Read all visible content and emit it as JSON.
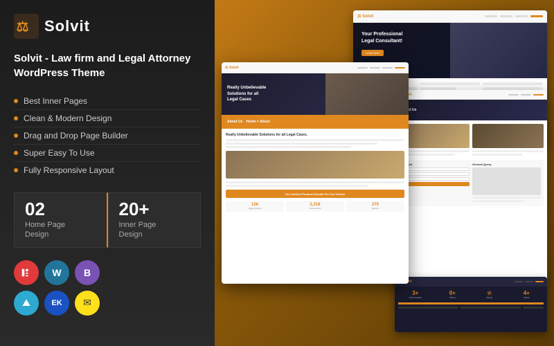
{
  "brand": {
    "name": "Solvit",
    "logo_symbol": "⚖"
  },
  "product": {
    "title": "Solvit - Law firm and Legal Attorney WordPress Theme",
    "features": [
      "Best Inner Pages",
      "Clean & Modern Design",
      "Drag and Drop Page Builder",
      "Super Easy To Use",
      "Fully Responsive Layout"
    ],
    "stats": [
      {
        "number": "02",
        "label": "Home Page\nDesign"
      },
      {
        "number": "20+",
        "label": "Inner Page\nDesign"
      }
    ]
  },
  "icons": [
    {
      "name": "Elementor",
      "symbol": "E",
      "class": "icon-elementor"
    },
    {
      "name": "WordPress",
      "symbol": "W",
      "class": "icon-wordpress"
    },
    {
      "name": "Bootstrap",
      "symbol": "B",
      "class": "icon-bootstrap"
    },
    {
      "name": "WPDiscuz",
      "symbol": "⛰",
      "class": "icon-wpdiscuz"
    },
    {
      "name": "EK",
      "symbol": "EK",
      "class": "icon-e"
    },
    {
      "name": "Mailchimp",
      "symbol": "✉",
      "class": "icon-mailchimp"
    }
  ],
  "screenshot_hero_title": "Your Professional Legal Consultant!",
  "screenshot_about_label": "About Us",
  "screenshot_section_title": "Really Unbelievable Solutions for all Legal Cases.",
  "screenshot_cta_title": "Our Actions Produce Results For Our Clients",
  "stats_numbers": [
    "126",
    "2,318",
    "270"
  ],
  "stats_labels": [
    "Happy Clients",
    "Cases Done",
    "Expert Lawyers"
  ],
  "colors": {
    "orange": "#e08820",
    "dark": "#1c1c1c",
    "darkBg": "#2a2a2a"
  }
}
